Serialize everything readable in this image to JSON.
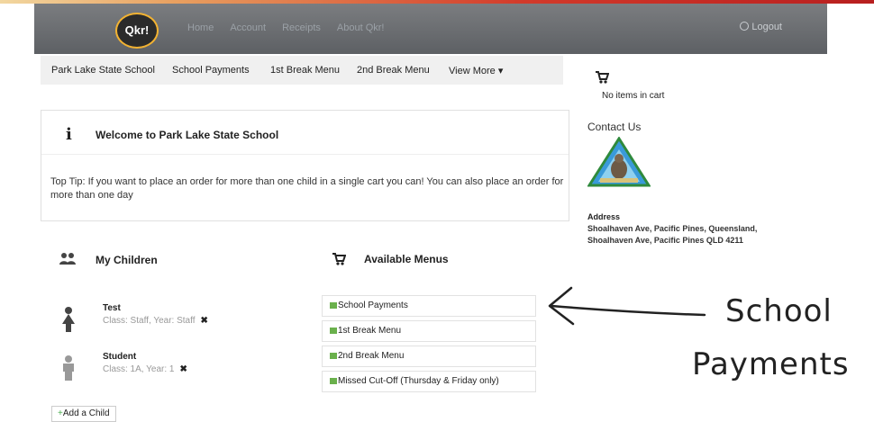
{
  "header": {
    "logo_text": "Qkr!",
    "nav": [
      "Home",
      "Account",
      "Receipts",
      "About Qkr!"
    ],
    "logout": "Logout"
  },
  "subnav": [
    "Park Lake State School",
    "School Payments",
    "1st Break Menu",
    "2nd Break Menu",
    "View More ▾"
  ],
  "cart": {
    "status": "No items in cart"
  },
  "welcome": {
    "title": "Welcome to Park Lake State School",
    "tip": "Top Tip: If you want to place an order for more than one child in a single cart you can! You can also place an order for more than one day"
  },
  "contact": {
    "title": "Contact Us",
    "address_label": "Address",
    "address_line1": "Shoalhaven Ave, Pacific Pines, Queensland,",
    "address_line2": "Shoalhaven Ave, Pacific Pines QLD 4211"
  },
  "children": {
    "title": "My Children",
    "items": [
      {
        "name": "Test",
        "detail": "Class: Staff, Year: Staff"
      },
      {
        "name": "Student",
        "detail": "Class: 1A, Year: 1"
      }
    ],
    "add_label": "Add a Child"
  },
  "menus": {
    "title": "Available Menus",
    "items": [
      "School Payments",
      "1st Break Menu",
      "2nd Break Menu",
      "Missed Cut-Off (Thursday & Friday only)"
    ]
  },
  "annotation": {
    "line1": "School",
    "line2": "Payments"
  },
  "colors": {
    "accent_green": "#6ab04c",
    "topbar": "#6a6d71",
    "logo_ring": "#f2b232"
  },
  "icons": [
    "cart-icon",
    "info-icon",
    "children-icon",
    "menus-cart-icon",
    "person-icon",
    "close-icon",
    "logout-icon"
  ]
}
